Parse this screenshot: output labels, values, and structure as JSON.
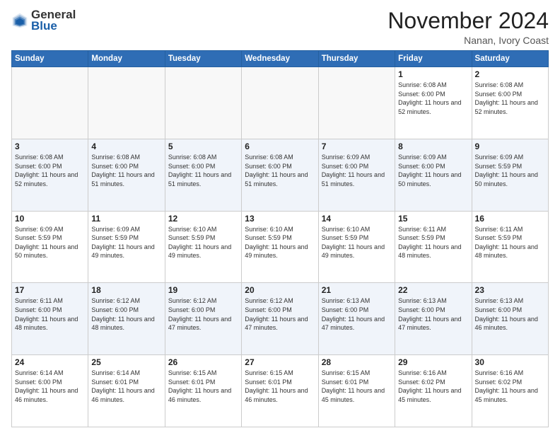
{
  "header": {
    "logo_line1": "General",
    "logo_line2": "Blue",
    "month": "November 2024",
    "location": "Nanan, Ivory Coast"
  },
  "days_of_week": [
    "Sunday",
    "Monday",
    "Tuesday",
    "Wednesday",
    "Thursday",
    "Friday",
    "Saturday"
  ],
  "weeks": [
    [
      {
        "day": "",
        "empty": true
      },
      {
        "day": "",
        "empty": true
      },
      {
        "day": "",
        "empty": true
      },
      {
        "day": "",
        "empty": true
      },
      {
        "day": "",
        "empty": true
      },
      {
        "day": "1",
        "sunrise": "6:08 AM",
        "sunset": "6:00 PM",
        "daylight": "11 hours and 52 minutes."
      },
      {
        "day": "2",
        "sunrise": "6:08 AM",
        "sunset": "6:00 PM",
        "daylight": "11 hours and 52 minutes."
      }
    ],
    [
      {
        "day": "3",
        "sunrise": "6:08 AM",
        "sunset": "6:00 PM",
        "daylight": "11 hours and 52 minutes."
      },
      {
        "day": "4",
        "sunrise": "6:08 AM",
        "sunset": "6:00 PM",
        "daylight": "11 hours and 51 minutes."
      },
      {
        "day": "5",
        "sunrise": "6:08 AM",
        "sunset": "6:00 PM",
        "daylight": "11 hours and 51 minutes."
      },
      {
        "day": "6",
        "sunrise": "6:08 AM",
        "sunset": "6:00 PM",
        "daylight": "11 hours and 51 minutes."
      },
      {
        "day": "7",
        "sunrise": "6:09 AM",
        "sunset": "6:00 PM",
        "daylight": "11 hours and 51 minutes."
      },
      {
        "day": "8",
        "sunrise": "6:09 AM",
        "sunset": "6:00 PM",
        "daylight": "11 hours and 50 minutes."
      },
      {
        "day": "9",
        "sunrise": "6:09 AM",
        "sunset": "5:59 PM",
        "daylight": "11 hours and 50 minutes."
      }
    ],
    [
      {
        "day": "10",
        "sunrise": "6:09 AM",
        "sunset": "5:59 PM",
        "daylight": "11 hours and 50 minutes."
      },
      {
        "day": "11",
        "sunrise": "6:09 AM",
        "sunset": "5:59 PM",
        "daylight": "11 hours and 49 minutes."
      },
      {
        "day": "12",
        "sunrise": "6:10 AM",
        "sunset": "5:59 PM",
        "daylight": "11 hours and 49 minutes."
      },
      {
        "day": "13",
        "sunrise": "6:10 AM",
        "sunset": "5:59 PM",
        "daylight": "11 hours and 49 minutes."
      },
      {
        "day": "14",
        "sunrise": "6:10 AM",
        "sunset": "5:59 PM",
        "daylight": "11 hours and 49 minutes."
      },
      {
        "day": "15",
        "sunrise": "6:11 AM",
        "sunset": "5:59 PM",
        "daylight": "11 hours and 48 minutes."
      },
      {
        "day": "16",
        "sunrise": "6:11 AM",
        "sunset": "5:59 PM",
        "daylight": "11 hours and 48 minutes."
      }
    ],
    [
      {
        "day": "17",
        "sunrise": "6:11 AM",
        "sunset": "6:00 PM",
        "daylight": "11 hours and 48 minutes."
      },
      {
        "day": "18",
        "sunrise": "6:12 AM",
        "sunset": "6:00 PM",
        "daylight": "11 hours and 48 minutes."
      },
      {
        "day": "19",
        "sunrise": "6:12 AM",
        "sunset": "6:00 PM",
        "daylight": "11 hours and 47 minutes."
      },
      {
        "day": "20",
        "sunrise": "6:12 AM",
        "sunset": "6:00 PM",
        "daylight": "11 hours and 47 minutes."
      },
      {
        "day": "21",
        "sunrise": "6:13 AM",
        "sunset": "6:00 PM",
        "daylight": "11 hours and 47 minutes."
      },
      {
        "day": "22",
        "sunrise": "6:13 AM",
        "sunset": "6:00 PM",
        "daylight": "11 hours and 47 minutes."
      },
      {
        "day": "23",
        "sunrise": "6:13 AM",
        "sunset": "6:00 PM",
        "daylight": "11 hours and 46 minutes."
      }
    ],
    [
      {
        "day": "24",
        "sunrise": "6:14 AM",
        "sunset": "6:00 PM",
        "daylight": "11 hours and 46 minutes."
      },
      {
        "day": "25",
        "sunrise": "6:14 AM",
        "sunset": "6:01 PM",
        "daylight": "11 hours and 46 minutes."
      },
      {
        "day": "26",
        "sunrise": "6:15 AM",
        "sunset": "6:01 PM",
        "daylight": "11 hours and 46 minutes."
      },
      {
        "day": "27",
        "sunrise": "6:15 AM",
        "sunset": "6:01 PM",
        "daylight": "11 hours and 46 minutes."
      },
      {
        "day": "28",
        "sunrise": "6:15 AM",
        "sunset": "6:01 PM",
        "daylight": "11 hours and 45 minutes."
      },
      {
        "day": "29",
        "sunrise": "6:16 AM",
        "sunset": "6:02 PM",
        "daylight": "11 hours and 45 minutes."
      },
      {
        "day": "30",
        "sunrise": "6:16 AM",
        "sunset": "6:02 PM",
        "daylight": "11 hours and 45 minutes."
      }
    ]
  ]
}
